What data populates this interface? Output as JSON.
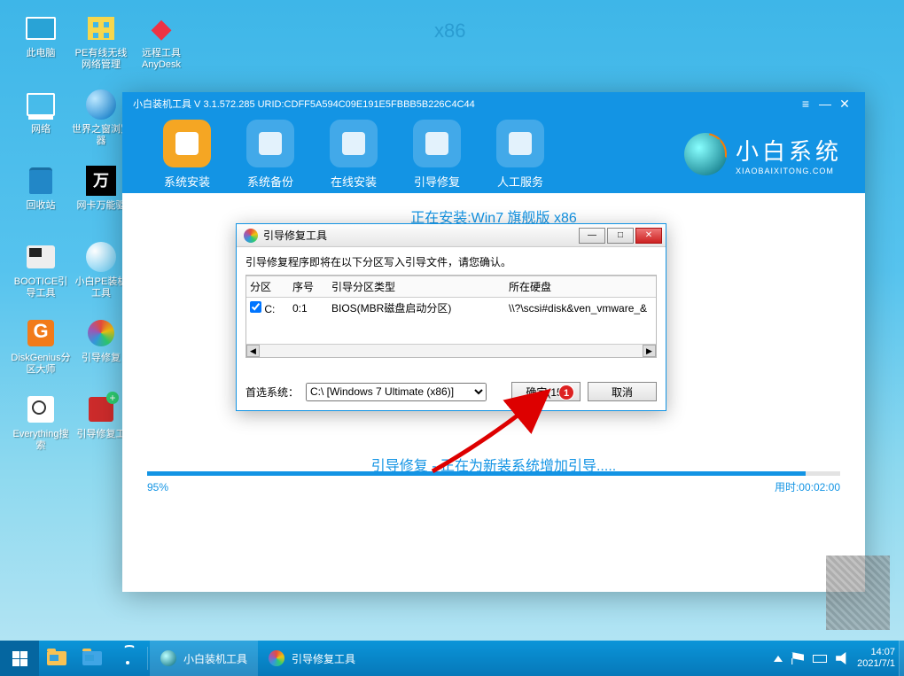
{
  "bg_label": "x86",
  "desktop_icons": [
    {
      "label": "此电脑",
      "glyph": "glyph-monitor"
    },
    {
      "label": "PE有线无线网络管理",
      "glyph": "glyph-net"
    },
    {
      "label": "远程工具AnyDesk",
      "glyph": "glyph-remote",
      "char": "◆"
    },
    {
      "label": "网络",
      "glyph": "glyph-network"
    },
    {
      "label": "世界之窗浏览器",
      "glyph": "glyph-globe"
    },
    {
      "label": "",
      "glyph": ""
    },
    {
      "label": "回收站",
      "glyph": "glyph-trash"
    },
    {
      "label": "网卡万能驱",
      "glyph": "glyph-10k",
      "char": "万"
    },
    {
      "label": "",
      "glyph": ""
    },
    {
      "label": "BOOTICE引导工具",
      "glyph": "glyph-usb"
    },
    {
      "label": "小白PE装机工具",
      "glyph": "glyph-pe"
    },
    {
      "label": "",
      "glyph": ""
    },
    {
      "label": "DiskGenius分区大师",
      "glyph": "glyph-disk",
      "char": "G"
    },
    {
      "label": "引导修复",
      "glyph": "glyph-color"
    },
    {
      "label": "",
      "glyph": ""
    },
    {
      "label": "Everything搜索",
      "glyph": "glyph-search"
    },
    {
      "label": "引导修复工",
      "glyph": "glyph-box"
    }
  ],
  "app": {
    "title": "小白装机工具 V 3.1.572.285 URID:CDFF5A594C09E191E5FBBB5B226C4C44",
    "controls": {
      "menu": "≡",
      "min": "—",
      "close": "✕"
    },
    "tools": [
      {
        "label": "系统安装",
        "active": true
      },
      {
        "label": "系统备份"
      },
      {
        "label": "在线安装"
      },
      {
        "label": "引导修复"
      },
      {
        "label": "人工服务"
      }
    ],
    "brand": {
      "cn": "小白系统",
      "en": "XIAOBAIXITONG.COM"
    },
    "status1": "正在安装:Win7 旗舰版 x86",
    "status2": "引导修复 - 正在为新装系统增加引导.....",
    "progress": {
      "pct": "95%",
      "fill": 95,
      "time_label": "用时:",
      "time": "00:02:00"
    }
  },
  "dialog": {
    "title": "引导修复工具",
    "message": "引导修复程序即将在以下分区写入引导文件，请您确认。",
    "columns": [
      "分区",
      "序号",
      "引导分区类型",
      "所在硬盘"
    ],
    "rows": [
      {
        "checked": true,
        "partition": "C:",
        "seq": "0:1",
        "type": "BIOS(MBR磁盘启动分区)",
        "disk": "\\\\?\\scsi#disk&ven_vmware_&"
      }
    ],
    "foot_label": "首选系统：",
    "select_value": "C:\\ [Windows 7 Ultimate (x86)]",
    "confirm": "确定(15)",
    "cancel": "取消"
  },
  "annotation": {
    "badge": "1"
  },
  "taskbar": {
    "apps": [
      {
        "label": "小白装机工具",
        "icon": "blue"
      },
      {
        "label": "引导修复工具",
        "icon": "color"
      }
    ],
    "time": "14:07",
    "date": "2021/7/1"
  }
}
